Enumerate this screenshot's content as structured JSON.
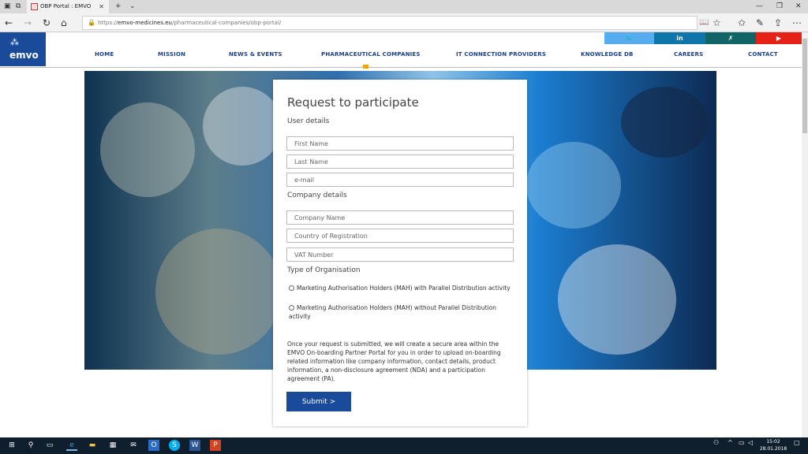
{
  "browser": {
    "tab_title": "OBP Portal : EMVO",
    "url_prefix": "https://",
    "url_domain": "emvo-medicines.eu",
    "url_path": "/pharmaceutical-companies/obp-portal/"
  },
  "site": {
    "logo_text": "emvo",
    "social": [
      "twitter",
      "in",
      "xing",
      "youtube"
    ],
    "nav": [
      "HOME",
      "MISSION",
      "NEWS & EVENTS",
      "PHARMACEUTICAL COMPANIES",
      "IT CONNECTION PROVIDERS",
      "KNOWLEDGE DB",
      "CAREERS",
      "CONTACT"
    ]
  },
  "form": {
    "title": "Request to participate",
    "user_section": "User details",
    "first_name_placeholder": "First Name",
    "last_name_placeholder": "Last Name",
    "email_placeholder": "e-mail",
    "company_section": "Company details",
    "company_name_placeholder": "Company Name",
    "country_placeholder": "Country of Registration",
    "vat_placeholder": "VAT Number",
    "org_section": "Type of Organisation",
    "option1": "Marketing Authorisation Holders (MAH) with Parallel Distribution activity",
    "option2": "Marketing Authorisation Holders (MAH) without Parallel Distribution activity",
    "note": "Once your request is submitted, we will create a secure area within the EMVO On-boarding Partner Portal for you in order to upload on-boarding related information like company information, contact details, product information, a non-disclosure agreement (NDA) and a participation agreement (PA).",
    "submit_label": "Submit >"
  },
  "taskbar": {
    "time": "15:02",
    "date": "28.01.2018"
  },
  "colors": {
    "brand_blue": "#1a4a9a",
    "twitter": "#55acee",
    "linkedin": "#0e76a8",
    "xing": "#126567",
    "youtube": "#e62117",
    "nav_marker": "#f0a400"
  }
}
